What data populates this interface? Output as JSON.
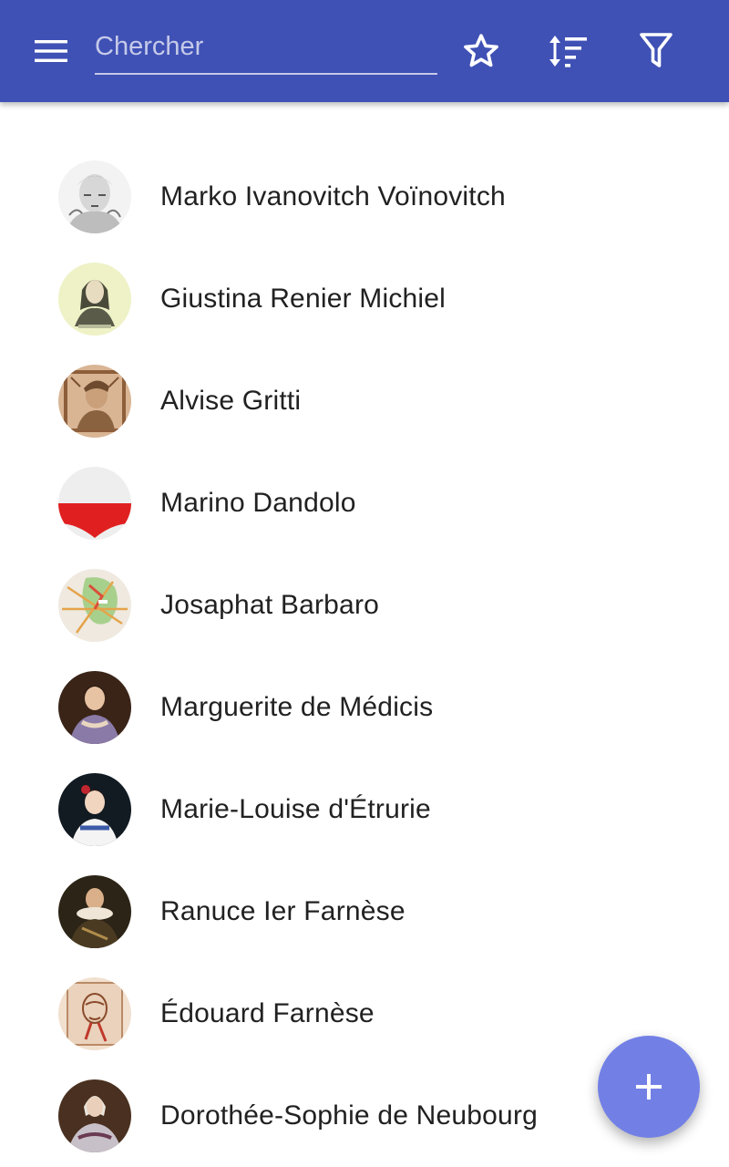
{
  "toolbar": {
    "menu_icon": "hamburger-menu-icon",
    "search_placeholder": "Chercher",
    "favorite_icon": "star-outline-icon",
    "sort_icon": "sort-icon",
    "filter_icon": "filter-icon",
    "background_color": "#3f51b5"
  },
  "list": {
    "items": [
      {
        "name": "Marko Ivanovitch Voïnovitch",
        "avatar": "portrait-engraving-man"
      },
      {
        "name": "Giustina Renier Michiel",
        "avatar": "portrait-engraving-woman"
      },
      {
        "name": "Alvise Gritti",
        "avatar": "portrait-woodcut-man"
      },
      {
        "name": "Marino Dandolo",
        "avatar": "coat-of-arms-red-white"
      },
      {
        "name": "Josaphat Barbaro",
        "avatar": "map"
      },
      {
        "name": "Marguerite de Médicis",
        "avatar": "portrait-painting-woman"
      },
      {
        "name": "Marie-Louise d'Étrurie",
        "avatar": "portrait-painting-woman"
      },
      {
        "name": "Ranuce Ier Farnèse",
        "avatar": "portrait-painting-man"
      },
      {
        "name": "Édouard Farnèse",
        "avatar": "portrait-drawing-man"
      },
      {
        "name": "Dorothée-Sophie de Neubourg",
        "avatar": "portrait-painting-woman"
      }
    ]
  },
  "fab": {
    "icon": "plus-icon",
    "color": "#7280e6"
  }
}
